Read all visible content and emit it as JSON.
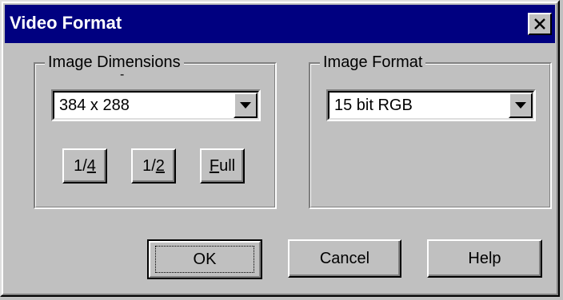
{
  "window": {
    "title": "Video Format",
    "close_icon": "close-x-icon"
  },
  "image_dimensions": {
    "label": "Image Dimensions",
    "mark": "-",
    "selected": "384 x 288",
    "buttons": {
      "quarter": {
        "before": "1/",
        "mnemonic": "4"
      },
      "half": {
        "before": "1/",
        "mnemonic": "2"
      },
      "full": {
        "mnemonic": "F",
        "after": "ull"
      }
    }
  },
  "image_format": {
    "label": "Image Format",
    "selected": "15 bit RGB"
  },
  "buttons": {
    "ok": "OK",
    "cancel": "Cancel",
    "help": "Help"
  },
  "colors": {
    "titlebar": "#000080",
    "face": "#c0c0c0",
    "field": "#ffffff"
  }
}
